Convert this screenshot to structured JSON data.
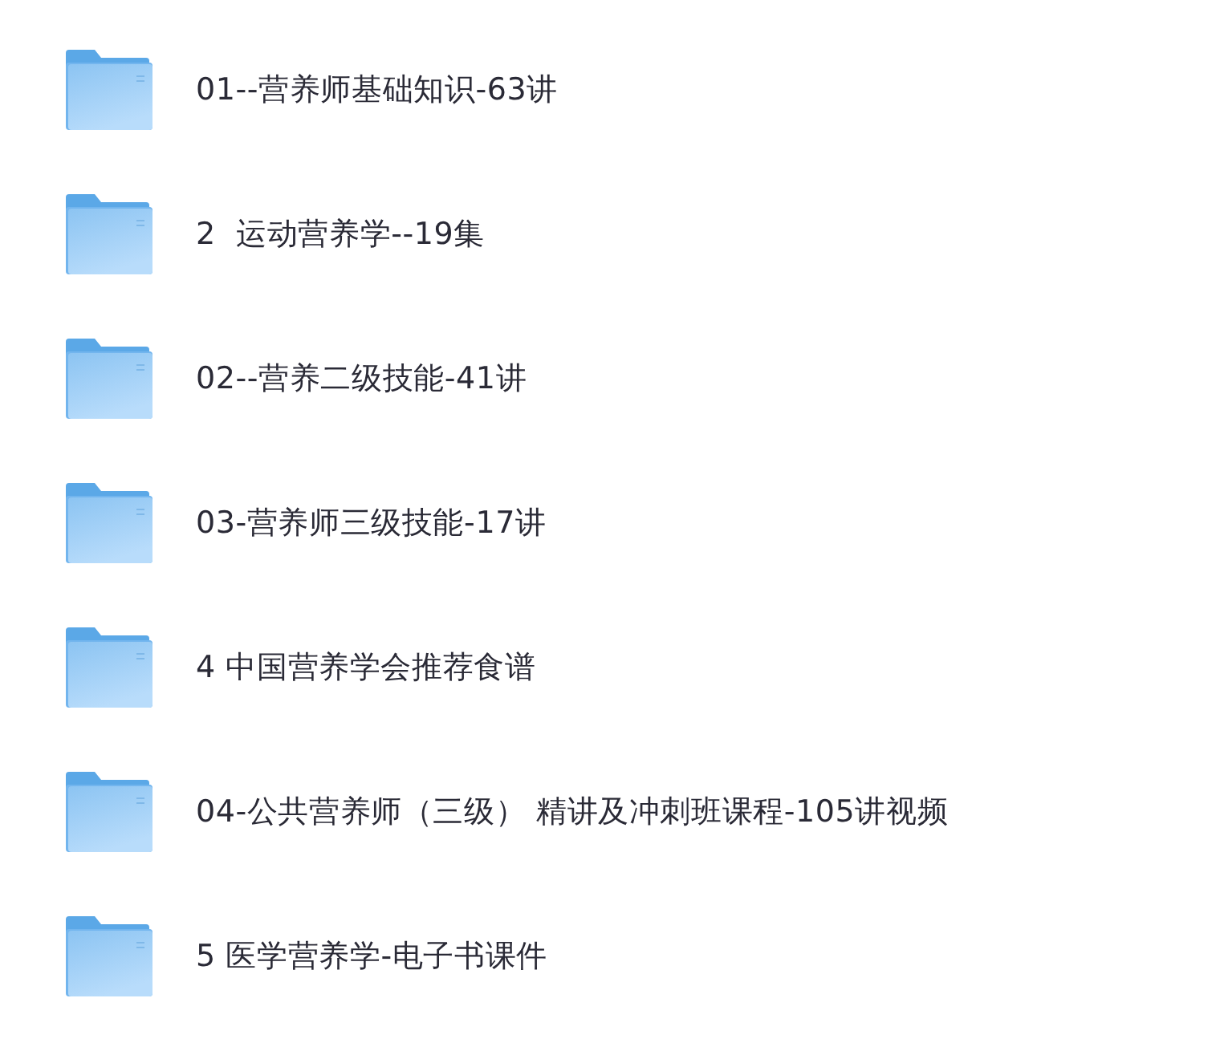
{
  "folders": [
    {
      "name": "01--营养师基础知识-63讲"
    },
    {
      "name": "2  运动营养学--19集"
    },
    {
      "name": "02--营养二级技能-41讲"
    },
    {
      "name": "03-营养师三级技能-17讲"
    },
    {
      "name": "4 中国营养学会推荐食谱"
    },
    {
      "name": "04-公共营养师（三级） 精讲及冲刺班课程-105讲视频"
    },
    {
      "name": "5 医学营养学-电子书课件"
    }
  ]
}
